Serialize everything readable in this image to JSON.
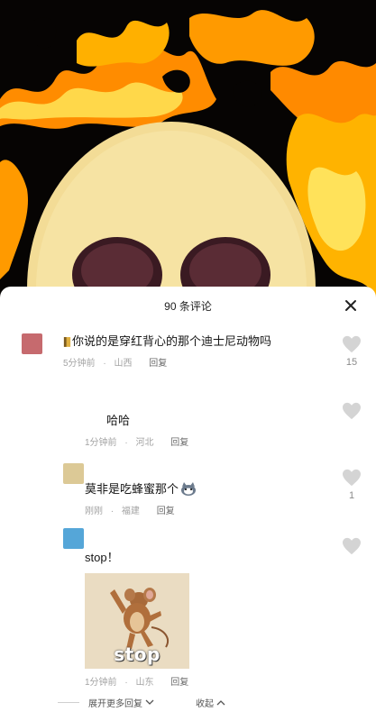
{
  "header": {
    "title": "90 条评论",
    "close_icon": "close-icon"
  },
  "comments": [
    {
      "avatar_color": "#c66a6e",
      "text": "你说的是穿红背心的那个迪士尼动物吗",
      "time": "5分钟前",
      "location": "山西",
      "reply_label": "回复",
      "like_count": "15"
    },
    {
      "avatar_color": "#ffffff",
      "text": "哈哈",
      "time": "1分钟前",
      "location": "河北",
      "reply_label": "回复",
      "like_count": ""
    },
    {
      "avatar_color": "#dcc996",
      "text": "莫非是吃蜂蜜那个",
      "time": "刚刚",
      "location": "福建",
      "reply_label": "回复",
      "like_count": "1"
    },
    {
      "avatar_color": "#55a6d8",
      "text": "stop！",
      "image_caption": "stop",
      "time": "1分钟前",
      "location": "山东",
      "reply_label": "回复",
      "like_count": ""
    }
  ],
  "footer": {
    "expand_label": "展开更多回复",
    "collapse_label": "收起"
  },
  "colors": {
    "flame": "#ff9d00",
    "face": "#f3dc96",
    "heart": "#d2d2d2"
  }
}
